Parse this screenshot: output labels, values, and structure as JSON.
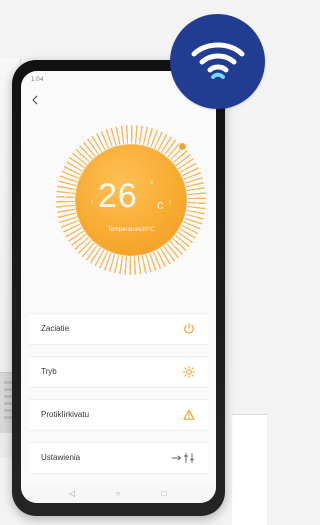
{
  "status": {
    "time": "1:04",
    "icons": "✱ ▾ ◢ ▮"
  },
  "thermostat": {
    "temperature": "26",
    "degree_symbol": "°",
    "unit": "c",
    "label": "Temperature30°C"
  },
  "controls": [
    {
      "label": "Zaciatie",
      "icon": "power-icon"
    },
    {
      "label": "Tryb",
      "icon": "sun-icon"
    },
    {
      "label": "Protiklírkivatu",
      "icon": "warning-icon"
    },
    {
      "label": "Ustawienia",
      "icon": "settings-icon"
    }
  ],
  "navigation": {
    "back": "back-arrow-icon",
    "back_nav": "triangle-back-icon",
    "home_nav": "circle-home-icon",
    "recent_nav": "square-recent-icon"
  },
  "colors": {
    "dial": "#f6a430",
    "badge": "#213c91",
    "accent": "#f39b27"
  }
}
